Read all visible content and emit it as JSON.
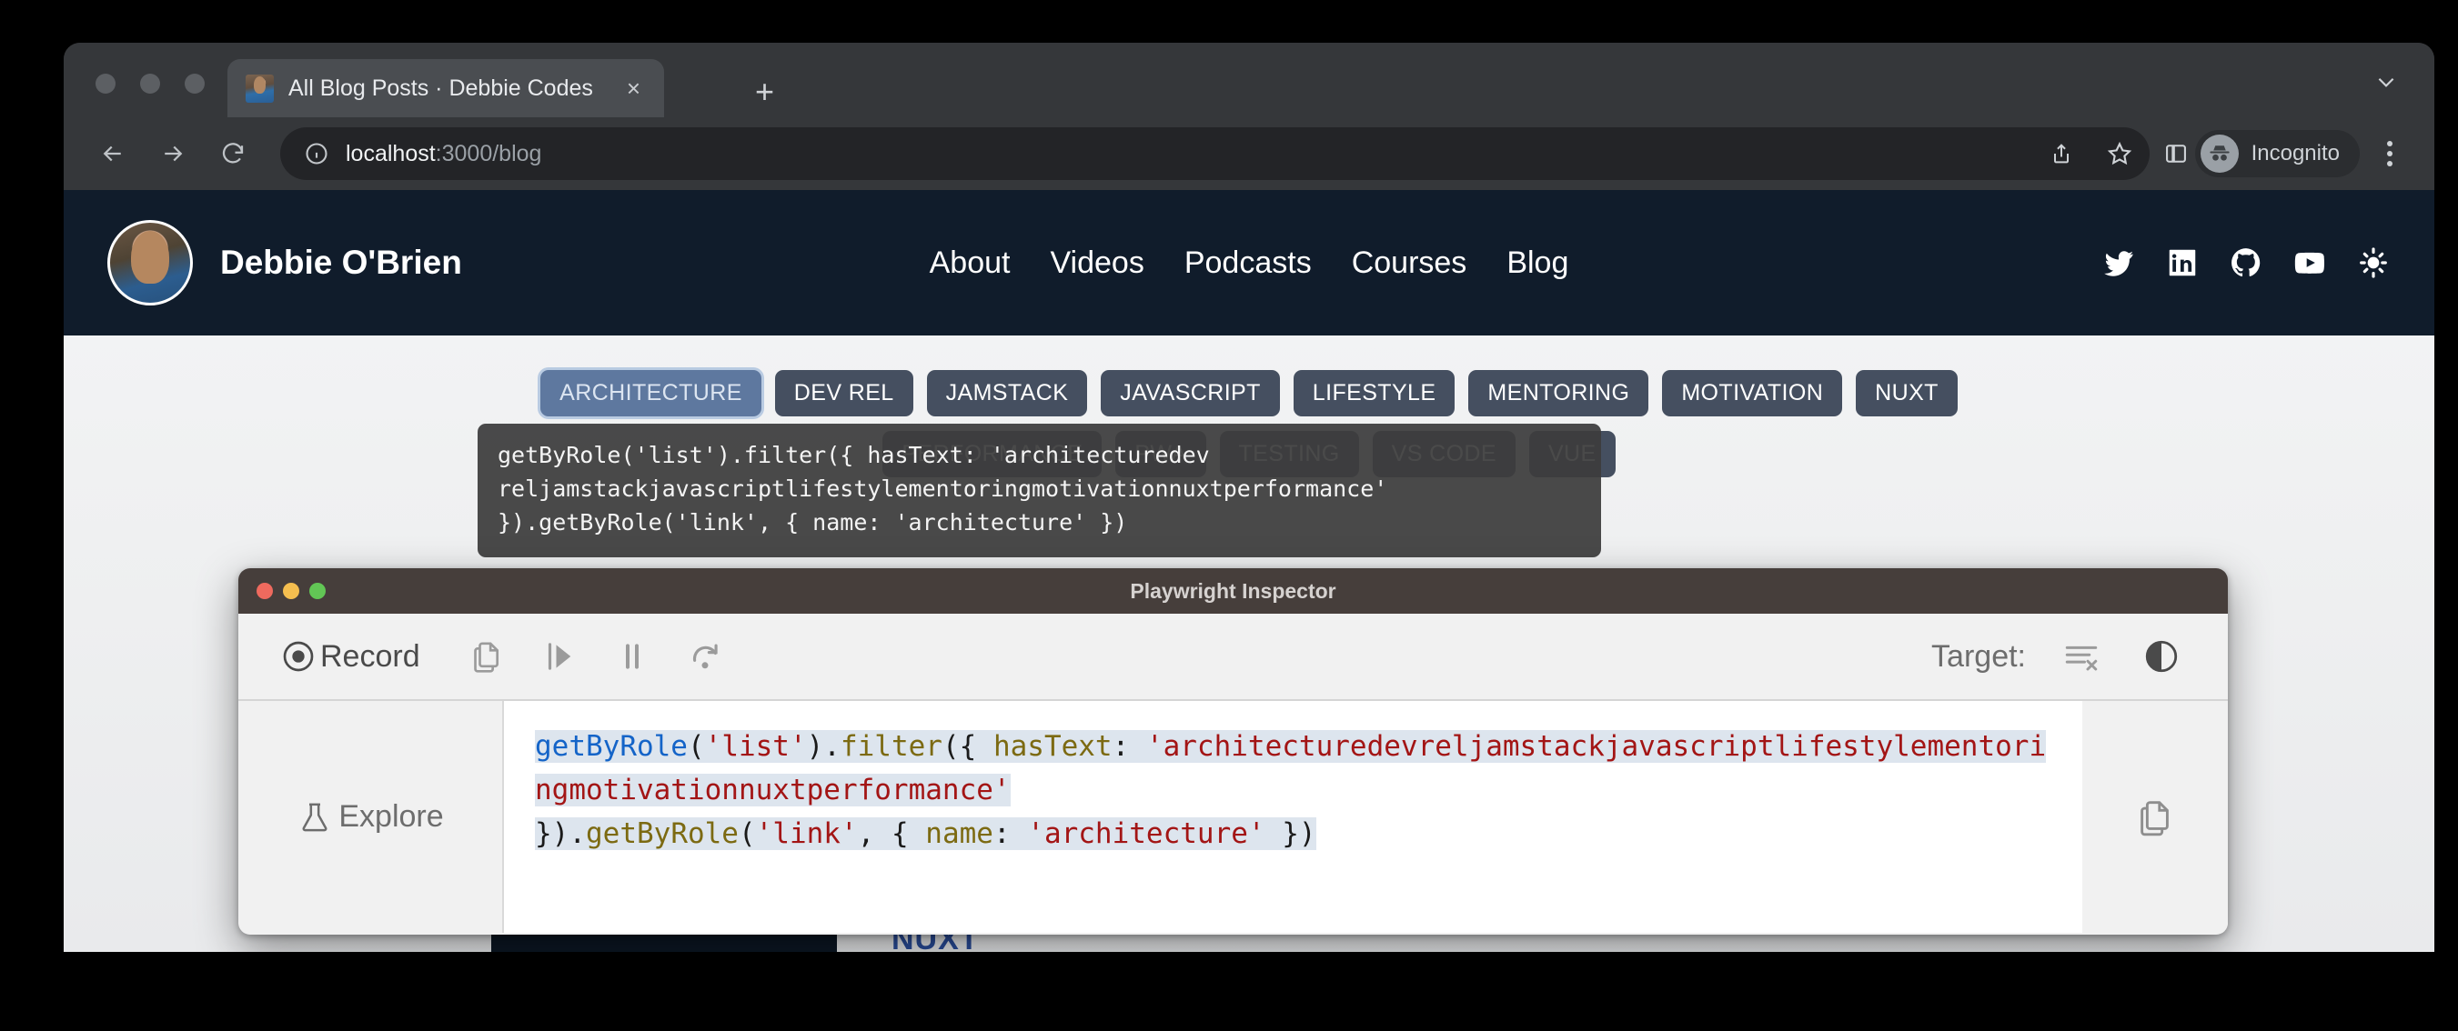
{
  "browser": {
    "tab": {
      "title": "All Blog Posts · Debbie Codes",
      "close_label": "×"
    },
    "new_tab_label": "+",
    "omnibox": {
      "host": "localhost",
      "path": ":3000/blog"
    },
    "profile": {
      "label": "Incognito"
    }
  },
  "site": {
    "brand_name": "Debbie O'Brien",
    "nav": [
      {
        "label": "About"
      },
      {
        "label": "Videos"
      },
      {
        "label": "Podcasts"
      },
      {
        "label": "Courses"
      },
      {
        "label": "Blog"
      }
    ],
    "socials": [
      {
        "name": "twitter-icon"
      },
      {
        "name": "linkedin-icon"
      },
      {
        "name": "github-icon"
      },
      {
        "name": "youtube-icon"
      },
      {
        "name": "theme-toggle-sun-icon"
      }
    ],
    "tags_row1": [
      {
        "label": "ARCHITECTURE",
        "active": true
      },
      {
        "label": "DEV REL",
        "active": false
      },
      {
        "label": "JAMSTACK",
        "active": false
      },
      {
        "label": "JAVASCRIPT",
        "active": false
      },
      {
        "label": "LIFESTYLE",
        "active": false
      },
      {
        "label": "MENTORING",
        "active": false
      },
      {
        "label": "MOTIVATION",
        "active": false
      },
      {
        "label": "NUXT",
        "active": false
      }
    ],
    "tags_row2": [
      {
        "label": "PERFORMANCE",
        "active": false
      },
      {
        "label": "PWA",
        "active": false
      },
      {
        "label": "TESTING",
        "active": false
      },
      {
        "label": "VS CODE",
        "active": false
      },
      {
        "label": "VUE",
        "active": false
      }
    ],
    "post_peek_title": "NUXT"
  },
  "tooltip": {
    "text": "getByRole('list').filter({ hasText: 'architecturedev\nreljamstackjavascriptlifestylementoringmotivationnuxtperformance'\n}).getByRole('link', { name: 'architecture' })"
  },
  "inspector": {
    "window_title": "Playwright Inspector",
    "record_label": "Record",
    "target_label": "Target:",
    "explore_label": "Explore",
    "toolbar_icons": [
      {
        "name": "copy-icon"
      },
      {
        "name": "step-over-icon"
      },
      {
        "name": "pause-icon"
      },
      {
        "name": "step-forward-icon"
      }
    ],
    "target_icons": [
      {
        "name": "clear-log-icon"
      },
      {
        "name": "contrast-toggle-icon"
      }
    ],
    "code": {
      "full": "getByRole('list').filter({ hasText: 'architecturedevreljamstackjavascriptlifestylementoringmotivationnuxtperformance' }).getByRole('link', { name: 'architecture' })",
      "tokens": [
        {
          "t": "getByRole",
          "c": "fn"
        },
        {
          "t": "(",
          "c": "punct"
        },
        {
          "t": "'list'",
          "c": "str"
        },
        {
          "t": ")",
          "c": "punct"
        },
        {
          "t": ".",
          "c": "punct"
        },
        {
          "t": "filter",
          "c": "prop"
        },
        {
          "t": "({ ",
          "c": "punct"
        },
        {
          "t": "hasText",
          "c": "prop"
        },
        {
          "t": ": ",
          "c": "punct"
        },
        {
          "t": "'architecturedevreljamstackjavascriptlifestylementoringmotivationnuxtperformance'",
          "c": "str"
        },
        {
          "t": "\n}).",
          "c": "punct"
        },
        {
          "t": "getByRole",
          "c": "prop"
        },
        {
          "t": "(",
          "c": "punct"
        },
        {
          "t": "'link'",
          "c": "str"
        },
        {
          "t": ", { ",
          "c": "punct"
        },
        {
          "t": "name",
          "c": "prop"
        },
        {
          "t": ": ",
          "c": "punct"
        },
        {
          "t": "'architecture'",
          "c": "str"
        },
        {
          "t": " })",
          "c": "punct"
        }
      ]
    },
    "traffic_lights": [
      {
        "color": "#ef6a5e"
      },
      {
        "color": "#f5be4f"
      },
      {
        "color": "#62c655"
      }
    ]
  },
  "colors": {
    "accent_tag": "#5e789f",
    "tag": "#454f60",
    "site_header": "#101c2b",
    "inspector_titlebar": "#463e3b",
    "code_fn": "#1464c8",
    "code_str": "#a31515",
    "code_prop": "#7c6a12",
    "selection": "#dde5ee"
  }
}
